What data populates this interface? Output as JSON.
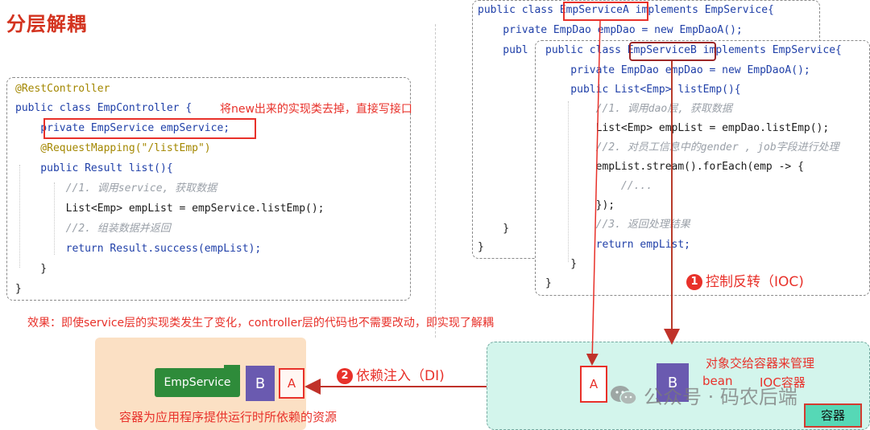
{
  "title": "分层解耦",
  "left_code": {
    "lines": [
      "@RestController",
      "public class EmpController {",
      "    private EmpService empService;",
      "    @RequestMapping(\"/listEmp\")",
      "    public Result list(){",
      "        //1. 调用service, 获取数据",
      "        List<Emp> empList = empService.listEmp();",
      "        //2. 组装数据并返回",
      "        return Result.success(empList);",
      "    }",
      "}"
    ],
    "annotation": "将new出来的实现类去掉，直接写接口"
  },
  "code_a": {
    "line1": "public class EmpServiceA implements EmpService{",
    "line2": "    private EmpDao empDao = new EmpDaoA();",
    "line3_prefix": "    publ",
    "line_close": "    }",
    "line_end": "}"
  },
  "code_b": {
    "lines": [
      "public class EmpServiceB implements EmpService{",
      "    private EmpDao empDao = new EmpDaoA();",
      "    public List<Emp> listEmp(){",
      "        //1. 调用dao层, 获取数据",
      "        List<Emp> empList = empDao.listEmp();",
      "        //2. 对员工信息中的gender , job字段进行处理",
      "        empList.stream().forEach(emp -> {",
      "            //...",
      "        });",
      "        //3. 返回处理结果",
      "        return empList;",
      "    }",
      "}"
    ]
  },
  "effect_note": "效果：即使service层的实现类发生了变化，controller层的代码也不需要改动，即实现了解耦",
  "ioc": {
    "num": "1",
    "label": "控制反转（IOC)"
  },
  "di": {
    "num": "2",
    "label": "依赖注入（DI)"
  },
  "left_panel": {
    "emp_service": "EmpService",
    "b": "B",
    "a": "A",
    "caption": "容器为应用程序提供运行时所依赖的资源"
  },
  "right_panel": {
    "a": "A",
    "b": "B",
    "line1": "对象交给容器来管理",
    "bean": "bean",
    "ioc_container": "IOC容器",
    "container_label": "容器"
  },
  "watermark": "公众号 · 码农后端",
  "colors": {
    "accent_red": "#e8312a",
    "title_red": "#d3331f",
    "container_bg": "#d3f5ec",
    "client_bg": "#fbe0c4",
    "service_green": "#2e8b3a",
    "doc_purple": "#6a5ab0"
  }
}
